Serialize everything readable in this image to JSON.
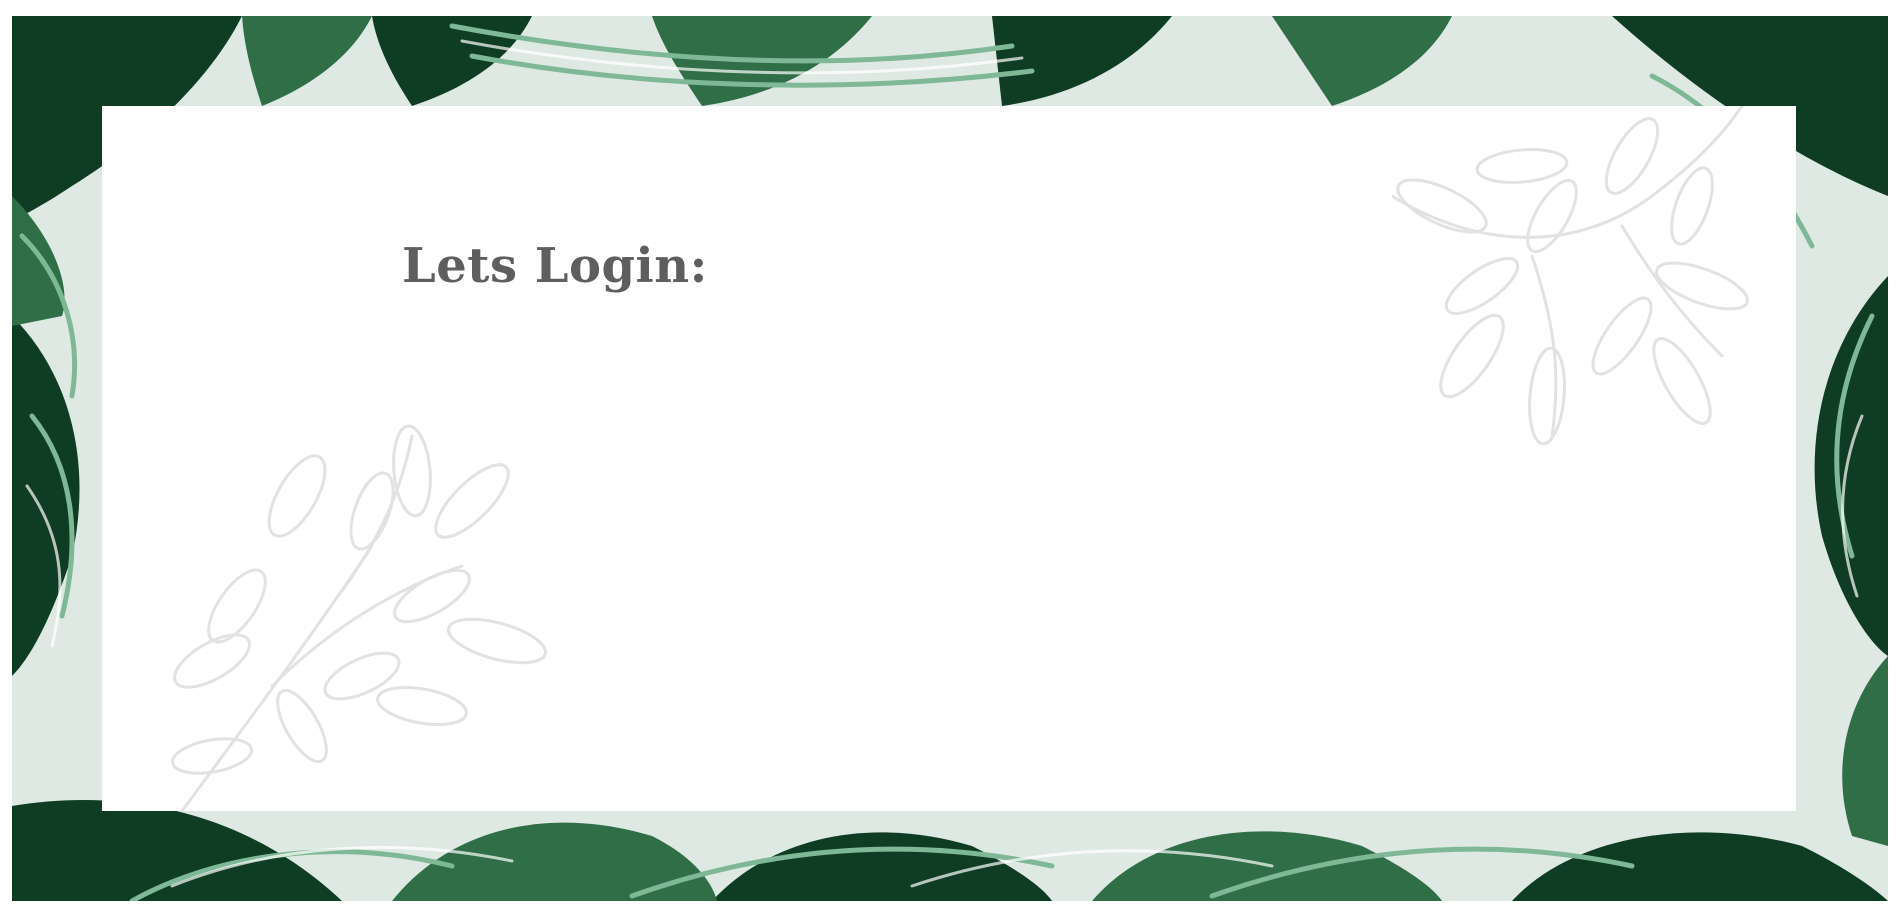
{
  "login": {
    "title": "Lets Login:"
  },
  "background": {
    "pattern_icon": "tropical-leaf-pattern",
    "colors": {
      "deep_green": "#0f3d24",
      "mid_green": "#2f6e47",
      "light_green": "#7fb896",
      "pale": "#dfe9e4"
    }
  },
  "card": {
    "background_color": "#ffffff",
    "title_color": "#5e5e5e",
    "decoration_icon": "leaf-sprig-outline",
    "decoration_color": "#e2e2e2"
  }
}
